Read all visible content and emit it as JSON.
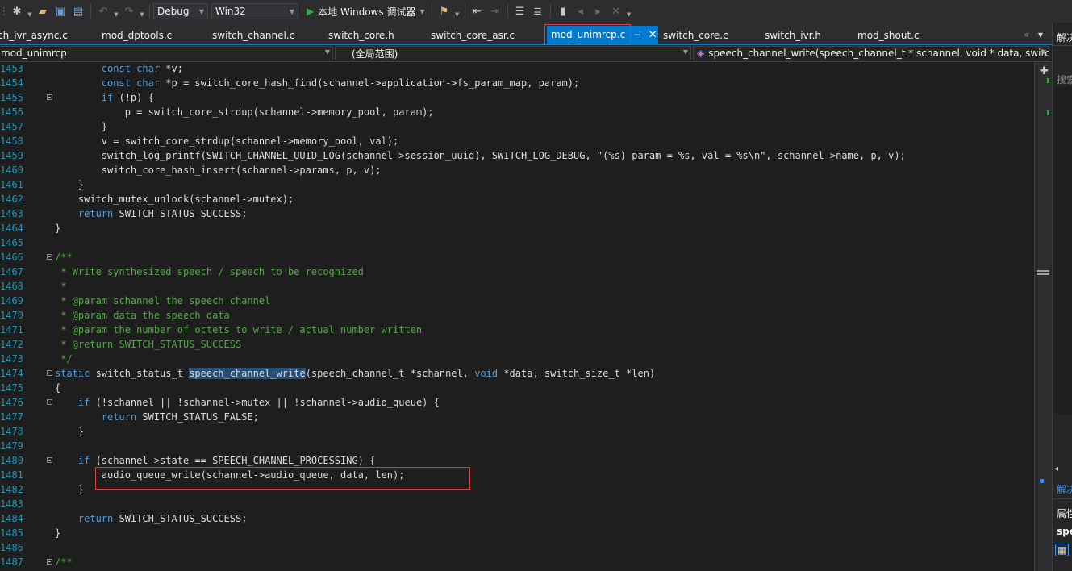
{
  "toolbar": {
    "config": "Debug",
    "platform": "Win32",
    "run_label": "本地 Windows 调试器"
  },
  "tabs": [
    {
      "label": "ch_ivr_async.c"
    },
    {
      "label": "mod_dptools.c"
    },
    {
      "label": "switch_channel.c"
    },
    {
      "label": "switch_core.h"
    },
    {
      "label": "switch_core_asr.c"
    },
    {
      "label": "mod_unimrcp.c",
      "active": true
    },
    {
      "label": "switch_core.c"
    },
    {
      "label": "switch_ivr.h"
    },
    {
      "label": "mod_shout.c"
    }
  ],
  "nav": {
    "project": "mod_unimrcp",
    "scope": "(全局范围)",
    "member": "speech_channel_write(speech_channel_t * schannel, void * data, switch_"
  },
  "editor": {
    "lines": [
      {
        "num": "1453",
        "text": "        const char *v;"
      },
      {
        "num": "1454",
        "text": "        const char *p = switch_core_hash_find(schannel->application->fs_param_map, param);"
      },
      {
        "num": "1455",
        "text": "        if (!p) {"
      },
      {
        "num": "1456",
        "text": "            p = switch_core_strdup(schannel->memory_pool, param);"
      },
      {
        "num": "1457",
        "text": "        }"
      },
      {
        "num": "1458",
        "text": "        v = switch_core_strdup(schannel->memory_pool, val);"
      },
      {
        "num": "1459",
        "text": "        switch_log_printf(SWITCH_CHANNEL_UUID_LOG(schannel->session_uuid), SWITCH_LOG_DEBUG, \"(%s) param = %s, val = %s\\n\", schannel->name, p, v);"
      },
      {
        "num": "1460",
        "text": "        switch_core_hash_insert(schannel->params, p, v);"
      },
      {
        "num": "1461",
        "text": "    }"
      },
      {
        "num": "1462",
        "text": "    switch_mutex_unlock(schannel->mutex);"
      },
      {
        "num": "1463",
        "text": "    return SWITCH_STATUS_SUCCESS;"
      },
      {
        "num": "1464",
        "text": "}"
      },
      {
        "num": "1465",
        "text": ""
      },
      {
        "num": "1466",
        "text": "/**"
      },
      {
        "num": "1467",
        "text": " * Write synthesized speech / speech to be recognized"
      },
      {
        "num": "1468",
        "text": " *"
      },
      {
        "num": "1469",
        "text": " * @param schannel the speech channel"
      },
      {
        "num": "1470",
        "text": " * @param data the speech data"
      },
      {
        "num": "1471",
        "text": " * @param the number of octets to write / actual number written"
      },
      {
        "num": "1472",
        "text": " * @return SWITCH_STATUS_SUCCESS"
      },
      {
        "num": "1473",
        "text": " */"
      },
      {
        "num": "1474",
        "text": "static switch_status_t speech_channel_write(speech_channel_t *schannel, void *data, switch_size_t *len)"
      },
      {
        "num": "1475",
        "text": "{"
      },
      {
        "num": "1476",
        "text": "    if (!schannel || !schannel->mutex || !schannel->audio_queue) {"
      },
      {
        "num": "1477",
        "text": "        return SWITCH_STATUS_FALSE;"
      },
      {
        "num": "1478",
        "text": "    }"
      },
      {
        "num": "1479",
        "text": ""
      },
      {
        "num": "1480",
        "text": "    if (schannel->state == SPEECH_CHANNEL_PROCESSING) {"
      },
      {
        "num": "1481",
        "text": "        audio_queue_write(schannel->audio_queue, data, len);"
      },
      {
        "num": "1482",
        "text": "    }"
      },
      {
        "num": "1483",
        "text": ""
      },
      {
        "num": "1484",
        "text": "    return SWITCH_STATUS_SUCCESS;"
      },
      {
        "num": "1485",
        "text": "}"
      },
      {
        "num": "1486",
        "text": ""
      },
      {
        "num": "1487",
        "text": "/**"
      }
    ],
    "selected_word": "speech_channel_write"
  },
  "right_panel": {
    "title": "解决",
    "search": "搜索",
    "sol_label": "解决",
    "props": "属性",
    "prop_item": "spe"
  },
  "colors": {
    "keyword": "#569cd6",
    "comment": "#57a64a",
    "line_number": "#2b91af",
    "accent": "#007acc",
    "highlight_box": "#e03c3c"
  }
}
